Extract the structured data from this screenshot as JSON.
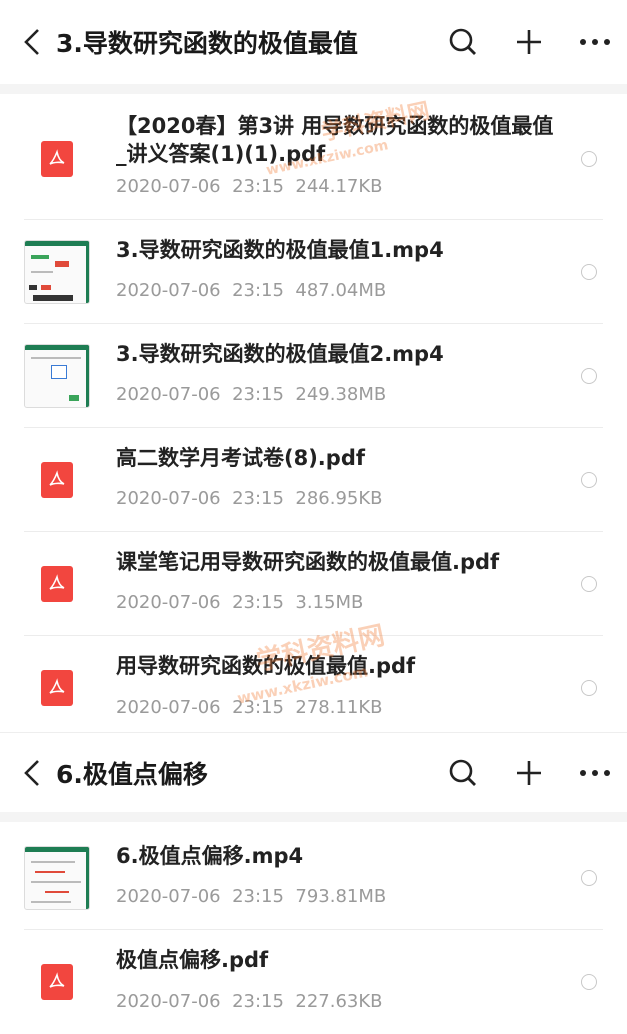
{
  "sections": [
    {
      "title": "3.导数研究函数的极值最值",
      "files": [
        {
          "name": "【2020春】第3讲 用导数研究函数的极值最值_讲义答案(1)(1).pdf",
          "date": "2020-07-06",
          "time": "23:15",
          "size": "244.17KB",
          "type": "pdf"
        },
        {
          "name": "3.导数研究函数的极值最值1.mp4",
          "date": "2020-07-06",
          "time": "23:15",
          "size": "487.04MB",
          "type": "video"
        },
        {
          "name": "3.导数研究函数的极值最值2.mp4",
          "date": "2020-07-06",
          "time": "23:15",
          "size": "249.38MB",
          "type": "video"
        },
        {
          "name": "高二数学月考试卷(8).pdf",
          "date": "2020-07-06",
          "time": "23:15",
          "size": "286.95KB",
          "type": "pdf"
        },
        {
          "name": "课堂笔记用导数研究函数的极值最值.pdf",
          "date": "2020-07-06",
          "time": "23:15",
          "size": "3.15MB",
          "type": "pdf"
        },
        {
          "name": "用导数研究函数的极值最值.pdf",
          "date": "2020-07-06",
          "time": "23:15",
          "size": "278.11KB",
          "type": "pdf"
        }
      ]
    },
    {
      "title": "6.极值点偏移",
      "files": [
        {
          "name": "6.极值点偏移.mp4",
          "date": "2020-07-06",
          "time": "23:15",
          "size": "793.81MB",
          "type": "video"
        },
        {
          "name": "极值点偏移.pdf",
          "date": "2020-07-06",
          "time": "23:15",
          "size": "227.63KB",
          "type": "pdf"
        }
      ]
    }
  ],
  "watermark": {
    "text_cn": "学科资料网",
    "text_url": "www.xkziw.com"
  },
  "colors": {
    "pdf": "#f2463f",
    "video_accent": "#1e7d53"
  },
  "icons": {
    "back": "back-arrow-icon",
    "search": "search-icon",
    "add": "plus-icon",
    "more": "more-icon"
  }
}
